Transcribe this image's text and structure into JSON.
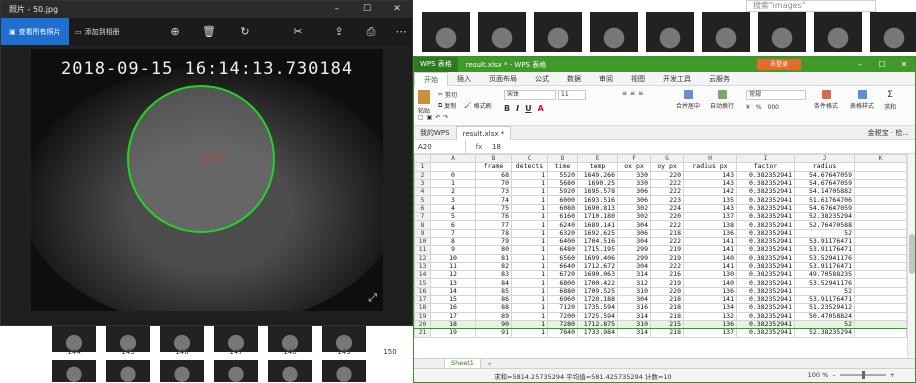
{
  "photos": {
    "title": "照片 - 50.jpg",
    "btn_primary": "查看所有照片",
    "btn_add": "添加到相册",
    "stamp": "2018-09-15 16:14:13.730184",
    "measure_label": "r(1.5)",
    "icons": [
      "zoom-in-icon",
      "delete-icon",
      "rotate-icon",
      "edit-icon",
      "share-icon",
      "print-icon",
      "more-icon"
    ]
  },
  "explorer": {
    "search_placeholder": "搜索\"images\"",
    "thumb_numbers": [
      "144",
      "145",
      "146",
      "147",
      "148",
      "149",
      "150"
    ]
  },
  "wps": {
    "title_logo": "WPS 表格",
    "title_file": "result.xlsx * - WPS 表格",
    "login": "未登录",
    "tabs": [
      "开始",
      "插入",
      "页面布局",
      "公式",
      "数据",
      "审阅",
      "视图",
      "开发工具",
      "云服务"
    ],
    "ribbon": {
      "paste": "粘贴",
      "cut": "剪切",
      "copy": "复制",
      "format_painter": "格式刷",
      "font": "宋体",
      "font_size": "11",
      "merge": "合并居中",
      "wrap": "自动换行",
      "number_format": "常规",
      "cond_format": "条件格式",
      "table_style": "表格样式",
      "sum": "求和",
      "filter": "筛选",
      "sort": "排序",
      "format": "格式",
      "row_col": "行和列",
      "worksheet": "工作表",
      "freeze": "冻结窗格",
      "find": "查找",
      "doc_assist": "金税宝 · 检...",
      "doc_tabs": [
        "我的WPS",
        "result.xlsx *"
      ]
    },
    "name_box": "A20",
    "fx": "fx",
    "formula_value": "18",
    "col_headers": [
      "A",
      "B",
      "C",
      "D",
      "E",
      "F",
      "G",
      "H",
      "I",
      "J",
      "K"
    ],
    "table_headers": [
      "",
      "frame",
      "detects",
      "time",
      "temp",
      "ox px",
      "oy px",
      "radius px",
      "factor",
      "radius",
      ""
    ],
    "rows": [
      [
        "0",
        "68",
        "1",
        "5520",
        "1649.266",
        "330",
        "220",
        "143",
        "0.382352941",
        "54.67647059"
      ],
      [
        "1",
        "70",
        "1",
        "5680",
        "1690.25",
        "330",
        "222",
        "143",
        "0.382352941",
        "54.67647059"
      ],
      [
        "2",
        "73",
        "1",
        "5920",
        "1695.578",
        "306",
        "222",
        "142",
        "0.382352941",
        "54.14705882"
      ],
      [
        "3",
        "74",
        "1",
        "6000",
        "1693.516",
        "306",
        "223",
        "135",
        "0.382352941",
        "51.61764706"
      ],
      [
        "4",
        "75",
        "1",
        "6080",
        "1690.813",
        "302",
        "224",
        "143",
        "0.382352941",
        "54.67647059"
      ],
      [
        "5",
        "76",
        "1",
        "6160",
        "1710.180",
        "302",
        "220",
        "137",
        "0.382352941",
        "52.38235294"
      ],
      [
        "6",
        "77",
        "1",
        "6240",
        "1689.141",
        "304",
        "222",
        "138",
        "0.382352941",
        "52.76470588"
      ],
      [
        "7",
        "78",
        "1",
        "6320",
        "1692.625",
        "306",
        "218",
        "136",
        "0.382352941",
        "52"
      ],
      [
        "8",
        "79",
        "1",
        "6400",
        "1704.516",
        "304",
        "222",
        "141",
        "0.382352941",
        "53.91176471"
      ],
      [
        "9",
        "80",
        "1",
        "6480",
        "1715.195",
        "299",
        "219",
        "141",
        "0.382352941",
        "53.91176471"
      ],
      [
        "10",
        "81",
        "1",
        "6560",
        "1699.406",
        "299",
        "219",
        "140",
        "0.382352941",
        "53.52941176"
      ],
      [
        "11",
        "82",
        "1",
        "6640",
        "1712.672",
        "304",
        "222",
        "141",
        "0.382352941",
        "53.91176471"
      ],
      [
        "12",
        "83",
        "1",
        "6720",
        "1690.063",
        "314",
        "216",
        "130",
        "0.382352941",
        "49.70588235"
      ],
      [
        "13",
        "84",
        "1",
        "6800",
        "1700.422",
        "312",
        "219",
        "140",
        "0.382352941",
        "53.52941176"
      ],
      [
        "14",
        "85",
        "1",
        "6880",
        "1709.525",
        "310",
        "220",
        "136",
        "0.382352941",
        "52"
      ],
      [
        "15",
        "86",
        "1",
        "6960",
        "1720.188",
        "304",
        "218",
        "141",
        "0.382352941",
        "53.91176471"
      ],
      [
        "16",
        "88",
        "1",
        "7120",
        "1735.594",
        "316",
        "218",
        "134",
        "0.382352941",
        "51.23529412"
      ],
      [
        "17",
        "89",
        "1",
        "7200",
        "1725.594",
        "314",
        "218",
        "132",
        "0.382352941",
        "50.47058824"
      ],
      [
        "18",
        "90",
        "1",
        "7280",
        "1712.875",
        "310",
        "215",
        "136",
        "0.382352941",
        "52"
      ],
      [
        "19",
        "91",
        "1",
        "7840",
        "1733.984",
        "314",
        "218",
        "137",
        "0.382352941",
        "52.38235294"
      ]
    ],
    "row_numbers": [
      "1",
      "2",
      "3",
      "4",
      "5",
      "6",
      "7",
      "8",
      "9",
      "10",
      "11",
      "12",
      "13",
      "14",
      "15",
      "16",
      "17",
      "18",
      "19",
      "20",
      "21"
    ],
    "selected_row_index": 18,
    "sheet_tab": "Sheet1",
    "status": "求和=5814.25735294   平均值=581.425735294   计数=10",
    "zoom": "100 %"
  },
  "colors": {
    "wps_green": "#3f9a2a",
    "photos_blue": "#1f6fd1",
    "circle": "#22d522"
  }
}
